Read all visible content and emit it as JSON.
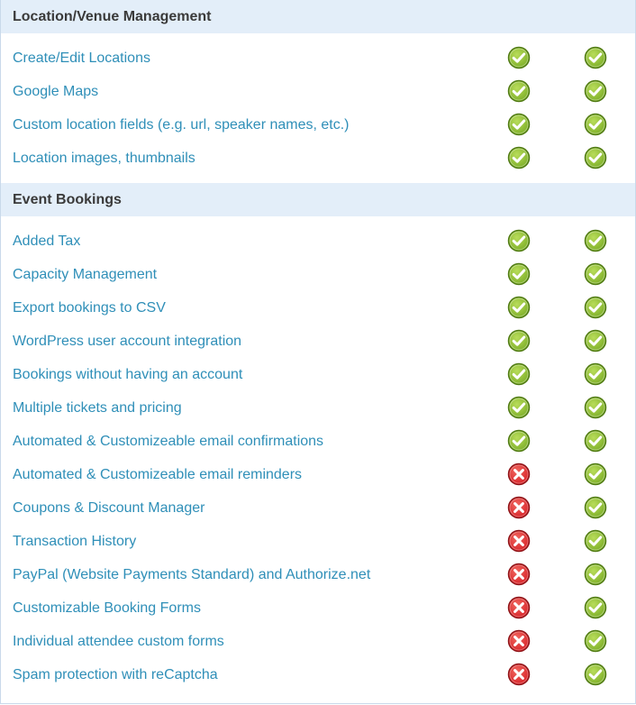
{
  "sections": [
    {
      "title": "Location/Venue Management",
      "rows": [
        {
          "label": "Create/Edit Locations",
          "free": "check-icon",
          "pro": "check-icon"
        },
        {
          "label": "Google Maps",
          "free": "check-icon",
          "pro": "check-icon"
        },
        {
          "label": "Custom location fields (e.g. url, speaker names, etc.)",
          "free": "check-icon",
          "pro": "check-icon"
        },
        {
          "label": "Location images, thumbnails",
          "free": "check-icon",
          "pro": "check-icon"
        }
      ]
    },
    {
      "title": "Event Bookings",
      "rows": [
        {
          "label": "Added Tax",
          "free": "check-icon",
          "pro": "check-icon"
        },
        {
          "label": "Capacity Management",
          "free": "check-icon",
          "pro": "check-icon"
        },
        {
          "label": "Export bookings to CSV",
          "free": "check-icon",
          "pro": "check-icon"
        },
        {
          "label": "WordPress user account integration",
          "free": "check-icon",
          "pro": "check-icon"
        },
        {
          "label": "Bookings without having an account",
          "free": "check-icon",
          "pro": "check-icon"
        },
        {
          "label": "Multiple tickets and pricing",
          "free": "check-icon",
          "pro": "check-icon"
        },
        {
          "label": "Automated & Customizeable email confirmations",
          "free": "check-icon",
          "pro": "check-icon"
        },
        {
          "label": "Automated & Customizeable email reminders",
          "free": "cross-icon",
          "pro": "check-icon"
        },
        {
          "label": "Coupons & Discount Manager",
          "free": "cross-icon",
          "pro": "check-icon"
        },
        {
          "label": "Transaction History",
          "free": "cross-icon",
          "pro": "check-icon"
        },
        {
          "label": "PayPal (Website Payments Standard) and Authorize.net",
          "free": "cross-icon",
          "pro": "check-icon"
        },
        {
          "label": "Customizable Booking Forms",
          "free": "cross-icon",
          "pro": "check-icon"
        },
        {
          "label": "Individual attendee custom forms",
          "free": "cross-icon",
          "pro": "check-icon"
        },
        {
          "label": "Spam protection with reCaptcha",
          "free": "cross-icon",
          "pro": "check-icon"
        }
      ]
    }
  ],
  "colors": {
    "header_bg": "#e3eef9",
    "label_text": "#2f8fb8",
    "check_green": "#7fb02a",
    "cross_red": "#d8262b"
  }
}
